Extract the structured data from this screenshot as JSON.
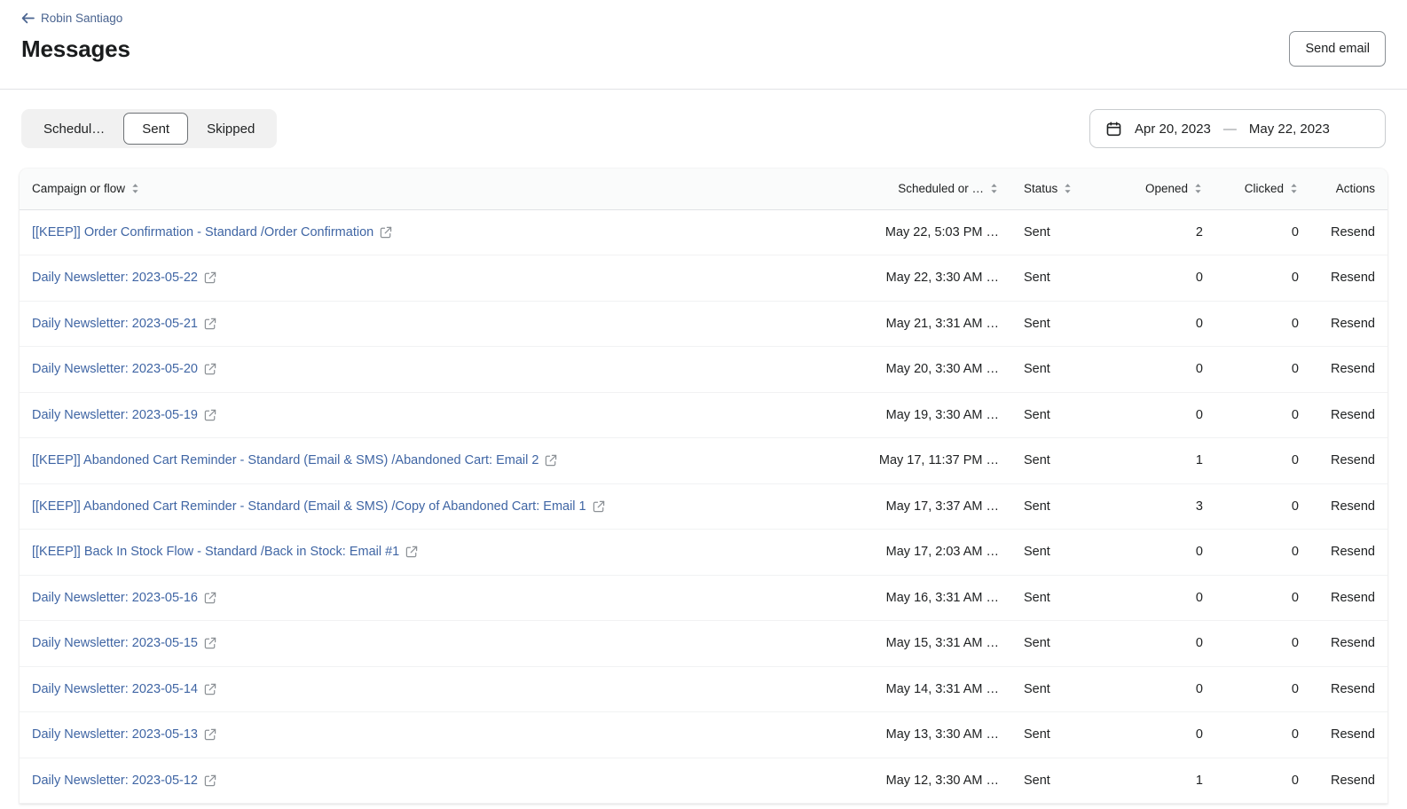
{
  "header": {
    "back_label": "Robin Santiago",
    "back_icon": "arrow-left-icon",
    "title": "Messages",
    "send_email_label": "Send email"
  },
  "filters": {
    "tabs": [
      {
        "label": "Schedul…",
        "selected": false
      },
      {
        "label": "Sent",
        "selected": true
      },
      {
        "label": "Skipped",
        "selected": false
      }
    ],
    "date_range": {
      "icon": "calendar-icon",
      "start": "Apr 20, 2023",
      "separator": "—",
      "end": "May 22, 2023"
    }
  },
  "table": {
    "columns": [
      {
        "label": "Campaign or flow",
        "sortable": true,
        "align": "left"
      },
      {
        "label": "Scheduled or …",
        "sortable": true,
        "align": "right"
      },
      {
        "label": "Status",
        "sortable": true,
        "align": "left"
      },
      {
        "label": "Opened",
        "sortable": true,
        "align": "right"
      },
      {
        "label": "Clicked",
        "sortable": true,
        "align": "right"
      },
      {
        "label": "Actions",
        "sortable": false,
        "align": "right"
      }
    ],
    "action_label": "Resend",
    "link_icon": "external-link-icon",
    "sort_icon": "sort-chevrons-icon",
    "rows": [
      {
        "campaign": "[[KEEP]] Order Confirmation - Standard /Order Confirmation",
        "scheduled": "May 22, 5:03 PM …",
        "status": "Sent",
        "opened": "2",
        "clicked": "0",
        "action": "Resend"
      },
      {
        "campaign": "Daily Newsletter: 2023-05-22",
        "scheduled": "May 22, 3:30 AM …",
        "status": "Sent",
        "opened": "0",
        "clicked": "0",
        "action": "Resend"
      },
      {
        "campaign": "Daily Newsletter: 2023-05-21",
        "scheduled": "May 21, 3:31 AM …",
        "status": "Sent",
        "opened": "0",
        "clicked": "0",
        "action": "Resend"
      },
      {
        "campaign": "Daily Newsletter: 2023-05-20",
        "scheduled": "May 20, 3:30 AM …",
        "status": "Sent",
        "opened": "0",
        "clicked": "0",
        "action": "Resend"
      },
      {
        "campaign": "Daily Newsletter: 2023-05-19",
        "scheduled": "May 19, 3:30 AM …",
        "status": "Sent",
        "opened": "0",
        "clicked": "0",
        "action": "Resend"
      },
      {
        "campaign": "[[KEEP]] Abandoned Cart Reminder - Standard (Email & SMS) /Abandoned Cart: Email 2",
        "scheduled": "May 17, 11:37 PM …",
        "status": "Sent",
        "opened": "1",
        "clicked": "0",
        "action": "Resend"
      },
      {
        "campaign": "[[KEEP]] Abandoned Cart Reminder - Standard (Email & SMS) /Copy of Abandoned Cart: Email 1",
        "scheduled": "May 17, 3:37 AM …",
        "status": "Sent",
        "opened": "3",
        "clicked": "0",
        "action": "Resend"
      },
      {
        "campaign": "[[KEEP]] Back In Stock Flow - Standard /Back in Stock: Email #1",
        "scheduled": "May 17, 2:03 AM …",
        "status": "Sent",
        "opened": "0",
        "clicked": "0",
        "action": "Resend"
      },
      {
        "campaign": "Daily Newsletter: 2023-05-16",
        "scheduled": "May 16, 3:31 AM …",
        "status": "Sent",
        "opened": "0",
        "clicked": "0",
        "action": "Resend"
      },
      {
        "campaign": "Daily Newsletter: 2023-05-15",
        "scheduled": "May 15, 3:31 AM …",
        "status": "Sent",
        "opened": "0",
        "clicked": "0",
        "action": "Resend"
      },
      {
        "campaign": "Daily Newsletter: 2023-05-14",
        "scheduled": "May 14, 3:31 AM …",
        "status": "Sent",
        "opened": "0",
        "clicked": "0",
        "action": "Resend"
      },
      {
        "campaign": "Daily Newsletter: 2023-05-13",
        "scheduled": "May 13, 3:30 AM …",
        "status": "Sent",
        "opened": "0",
        "clicked": "0",
        "action": "Resend"
      },
      {
        "campaign": "Daily Newsletter: 2023-05-12",
        "scheduled": "May 12, 3:30 AM …",
        "status": "Sent",
        "opened": "1",
        "clicked": "0",
        "action": "Resend"
      }
    ]
  },
  "colors": {
    "link": "#3f65a4",
    "text": "#202223",
    "border": "#e1e3e5",
    "header_bg": "#fafbfb",
    "segment_bg": "#f1f1f1"
  }
}
